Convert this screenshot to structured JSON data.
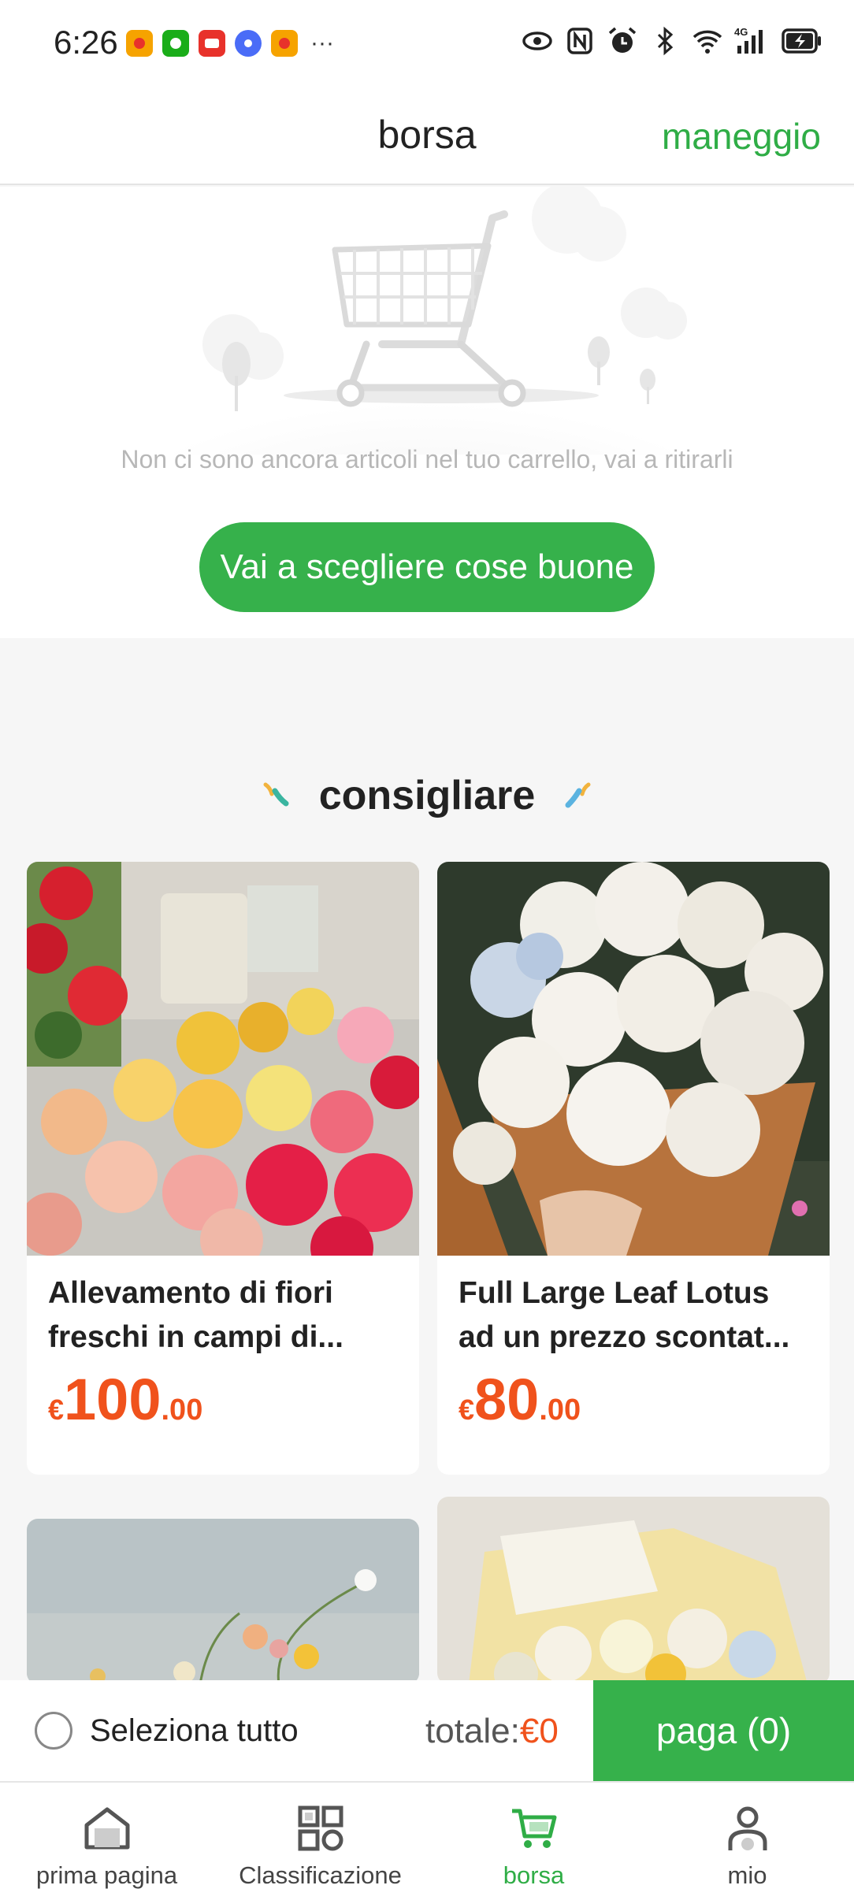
{
  "status_bar": {
    "time": "6:26",
    "more": "···",
    "network": "4G"
  },
  "header": {
    "title": "borsa",
    "manage_label": "maneggio"
  },
  "empty_cart": {
    "message": "Non ci sono ancora articoli nel tuo carrello, vai a ritirarli",
    "button_label": "Vai a scegliere cose buone"
  },
  "recommend": {
    "title": "consigliare",
    "products": [
      {
        "name": "Allevamento di fiori freschi in campi di...",
        "currency": "€",
        "price_int": "100",
        "price_dec": ".00"
      },
      {
        "name": "Full Large Leaf Lotus ad un prezzo scontat...",
        "currency": "€",
        "price_int": "80",
        "price_dec": ".00"
      }
    ]
  },
  "action_bar": {
    "select_all_label": "Seleziona tutto",
    "total_label": "totale:",
    "total_value": "€0",
    "pay_label": "paga (0)"
  },
  "tab_bar": {
    "items": [
      {
        "label": "prima pagina",
        "icon": "home-icon"
      },
      {
        "label": "Classificazione",
        "icon": "category-icon"
      },
      {
        "label": "borsa",
        "icon": "cart-icon",
        "active": true
      },
      {
        "label": "mio",
        "icon": "profile-icon"
      }
    ]
  },
  "colors": {
    "accent": "#36b14b",
    "price": "#f0521c"
  }
}
